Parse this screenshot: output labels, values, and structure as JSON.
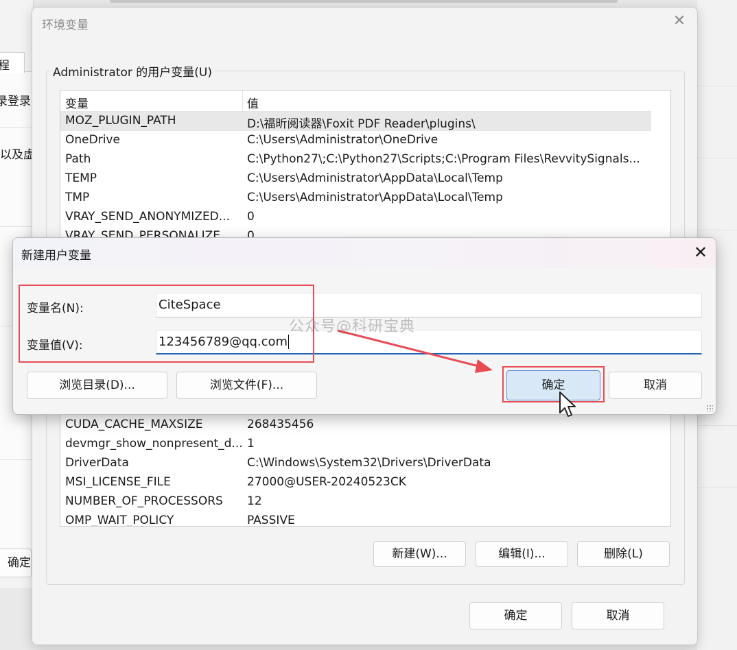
{
  "background_window": {
    "tab_fragment": "程",
    "text_fragment_1": "录登录",
    "text_fragment_2": "以及虚",
    "ok_fragment": "确定"
  },
  "env_dialog": {
    "title": "环境变量",
    "close_glyph": "✕",
    "user_group_label": "Administrator 的用户变量(U)",
    "columns": {
      "name": "变量",
      "value": "值"
    },
    "user_rows": [
      {
        "name": "MOZ_PLUGIN_PATH",
        "value": "D:\\福昕阅读器\\Foxit PDF Reader\\plugins\\"
      },
      {
        "name": "OneDrive",
        "value": "C:\\Users\\Administrator\\OneDrive"
      },
      {
        "name": "Path",
        "value": "C:\\Python27\\;C:\\Python27\\Scripts;C:\\Program Files\\RevvitySignals..."
      },
      {
        "name": "TEMP",
        "value": "C:\\Users\\Administrator\\AppData\\Local\\Temp"
      },
      {
        "name": "TMP",
        "value": "C:\\Users\\Administrator\\AppData\\Local\\Temp"
      },
      {
        "name": "VRAY_SEND_ANONYMIZED...",
        "value": "0"
      },
      {
        "name": "VRAY_SEND_PERSONALIZE...",
        "value": "0"
      }
    ],
    "system_rows": [
      {
        "name": "CUDA_CACHE_MAXSIZE",
        "value": "268435456"
      },
      {
        "name": "devmgr_show_nonpresent_d...",
        "value": "1"
      },
      {
        "name": "DriverData",
        "value": "C:\\Windows\\System32\\Drivers\\DriverData"
      },
      {
        "name": "MSI_LICENSE_FILE",
        "value": "27000@USER-20240523CK"
      },
      {
        "name": "NUMBER_OF_PROCESSORS",
        "value": "12"
      },
      {
        "name": "OMP_WAIT_POLICY",
        "value": "PASSIVE"
      }
    ],
    "buttons": {
      "new": "新建(W)...",
      "edit": "编辑(I)...",
      "delete": "删除(L)",
      "ok": "确定",
      "cancel": "取消"
    }
  },
  "new_var_dialog": {
    "title": "新建用户变量",
    "close_glyph": "✕",
    "name_label": "变量名(N):",
    "name_value": "CiteSpace",
    "value_label": "变量值(V):",
    "value_value": "123456789@qq.com",
    "browse_dir": "浏览目录(D)...",
    "browse_file": "浏览文件(F)...",
    "ok": "确定",
    "cancel": "取消"
  },
  "watermark": "公众号@科研宝典",
  "colors": {
    "annotation_red": "#e94b55",
    "accent_blue": "#1f63b8"
  }
}
